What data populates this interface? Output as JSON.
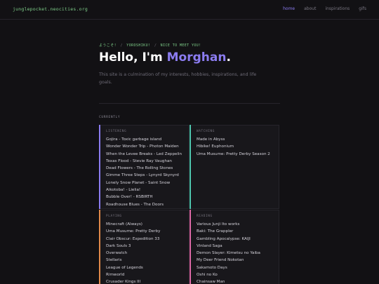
{
  "site": {
    "name": "junglepocket.neocities.org"
  },
  "nav": {
    "items": [
      {
        "label": "home"
      },
      {
        "label": "about"
      },
      {
        "label": "inspirations"
      },
      {
        "label": "gifs"
      }
    ],
    "active": "home"
  },
  "hero": {
    "greetings": [
      "ようこそ!",
      "YOROSHIKU!",
      "NICE TO MEET YOU!"
    ],
    "separator": "/",
    "hello_prefix": "Hello, I'm ",
    "name": "Morghan",
    "hello_suffix": ".",
    "intro": "This site is a culmination of my interests, hobbies, inspirations, and life goals."
  },
  "currently": {
    "heading": "CURRENTLY",
    "cards": {
      "listening": {
        "title": "LISTENING",
        "accent": "#8b7cf0",
        "items": [
          "Gojira - Toxic garbage island",
          "Wonder Wonder Trip - Photon Maiden",
          "When the Levee Breaks - Led Zeppelin",
          "Texas Flood - Stevie Ray Vaughan",
          "Dead Flowers - The Rolling Stones",
          "Gimme Three Steps - Lynyrd Skynyrd",
          "Lonely Snow Planet - Saint Snow",
          "Aikotoba! - Lielia!",
          "Bubble Over! - RSBIRTH",
          "Roadhouse Blues - The Doors"
        ]
      },
      "watching": {
        "title": "WATCHING",
        "accent": "#4fc9b0",
        "items": [
          "Made in Abyss",
          "Hibike! Euphonium",
          "Uma Musume: Pretty Derby Season 2"
        ]
      },
      "playing": {
        "title": "PLAYING",
        "accent": "#e0894a",
        "items": [
          "Minecraft (Always)",
          "Uma Musume: Pretty Derby",
          "Clair Obscur: Expedition 33",
          "Dark Souls 3",
          "Overwatch",
          "Stellaris",
          "League of Legends",
          "Rimworld",
          "Crusader Kings III"
        ]
      },
      "reading": {
        "title": "READING",
        "accent": "#e06aa8",
        "items": [
          "Various Junji Ito works",
          "Baki: The Grappler",
          "Gambling Apocalypse: KAIJI",
          "Vinland Saga",
          "Demon Slayer: Kimetsu no Yaiba",
          "My Deer Friend Nokotan",
          "Sakamoto Days",
          "Oshi no Ko",
          "Chainsaw Man"
        ]
      }
    }
  }
}
